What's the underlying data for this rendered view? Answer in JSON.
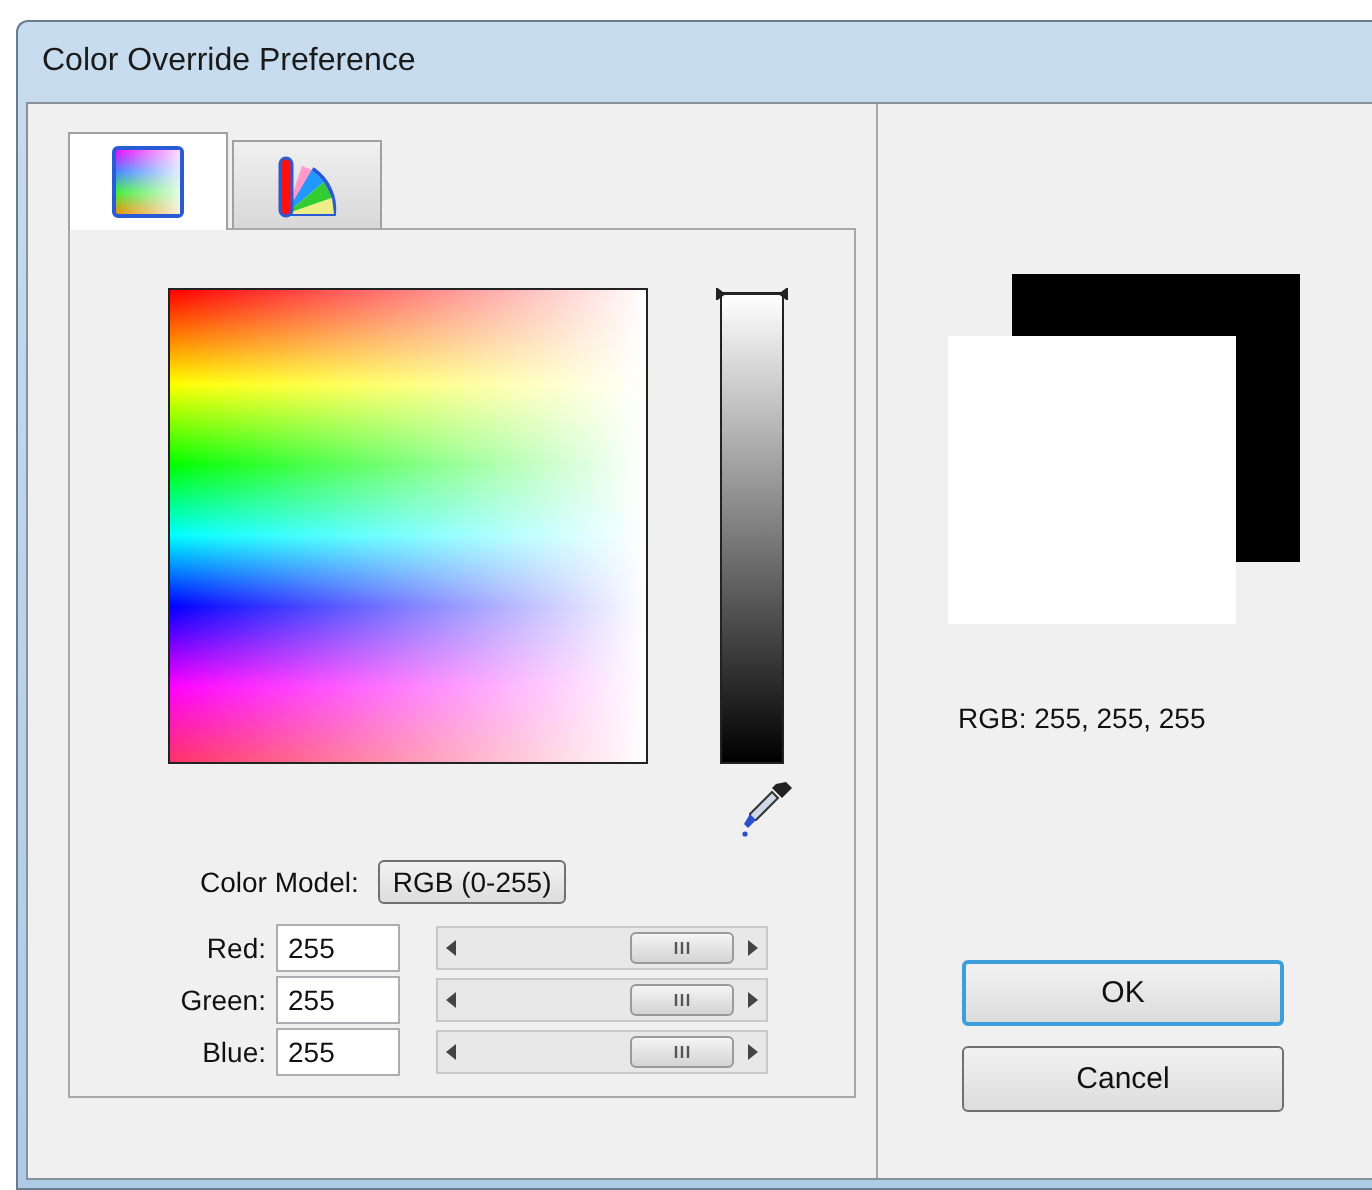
{
  "window": {
    "title": "Color Override Preference"
  },
  "tabs": [
    {
      "kind": "gradient",
      "selected": true
    },
    {
      "kind": "wheel",
      "selected": false
    }
  ],
  "brightness": {
    "level": 1
  },
  "color_model": {
    "label": "Color Model:",
    "value": "RGB (0-255)"
  },
  "channels": [
    {
      "label": "Red:",
      "value": "255"
    },
    {
      "label": "Green:",
      "value": "255"
    },
    {
      "label": "Blue:",
      "value": "255"
    }
  ],
  "preview": {
    "reading": "RGB: 255, 255, 255"
  },
  "buttons": [
    {
      "label": "OK",
      "default": true
    },
    {
      "label": "Cancel",
      "default": false
    }
  ]
}
